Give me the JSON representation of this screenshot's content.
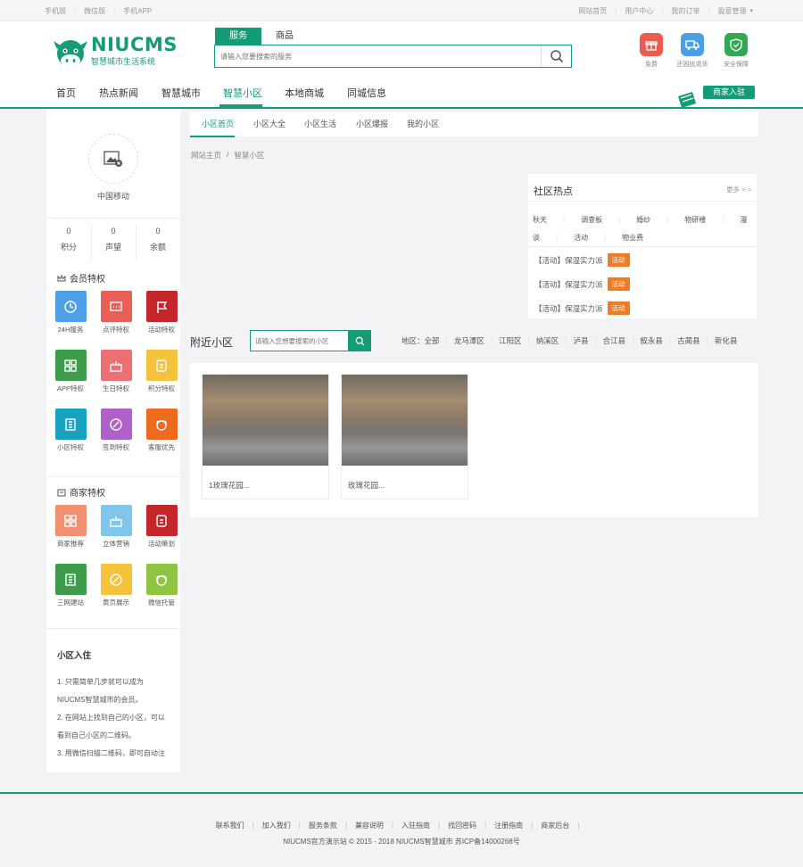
{
  "topbar": {
    "left": [
      "手机版",
      "微信版",
      "手机APP"
    ],
    "right": [
      "网站首页",
      "用户中心",
      "我的订单",
      "盈意管理"
    ]
  },
  "logo": {
    "brand": "NIUCMS",
    "sub": "智慧城市生活系统"
  },
  "search": {
    "tabs": [
      "服务",
      "商品"
    ],
    "placeholder": "请输入您要搜索的服务"
  },
  "header_icons": [
    {
      "label": "免费",
      "color": "#ee5b4c"
    },
    {
      "label": "还困扰退货",
      "color": "#4aa0e2"
    },
    {
      "label": "安全保障",
      "color": "#32a853"
    }
  ],
  "nav": {
    "items": [
      "首页",
      "热点新闻",
      "智慧城市",
      "智慧小区",
      "本地商城",
      "同城信息"
    ],
    "active": 3,
    "join_label": "商家入驻"
  },
  "sidebar": {
    "operator": "中国移动",
    "stats": [
      {
        "value": "0",
        "label": "积分"
      },
      {
        "value": "0",
        "label": "声望"
      },
      {
        "value": "0",
        "label": "余额"
      }
    ],
    "member_title": "会员特权",
    "member_tiles": [
      {
        "label": "24H服务",
        "color": "#4d9fe8"
      },
      {
        "label": "点评特权",
        "color": "#e85f55"
      },
      {
        "label": "活动特权",
        "color": "#c5262a"
      },
      {
        "label": "APP特权",
        "color": "#3e9d4a"
      },
      {
        "label": "生日特权",
        "color": "#ec6f73"
      },
      {
        "label": "积分特权",
        "color": "#f4c23b"
      },
      {
        "label": "小区特权",
        "color": "#17a2c0"
      },
      {
        "label": "签到特权",
        "color": "#b061c9"
      },
      {
        "label": "客服优先",
        "color": "#f06a1d"
      }
    ],
    "merchant_title": "商家特权",
    "merchant_tiles": [
      {
        "label": "商家推荐",
        "color": "#f28f70"
      },
      {
        "label": "立体营销",
        "color": "#7fc5ec"
      },
      {
        "label": "活动策划",
        "color": "#c5262a"
      },
      {
        "label": "三网建站",
        "color": "#3e9d4a"
      },
      {
        "label": "黄页展示",
        "color": "#f4c23b"
      },
      {
        "label": "微信托管",
        "color": "#8fc541"
      }
    ],
    "join_title": "小区入住",
    "join_steps": [
      "1. 只需简单几步就可以成为",
      "NIUCMS智慧城市的会员。",
      "2. 在网站上找到自己的小区，可以",
      "看到自己小区的二维码。",
      "3. 用微信扫描二维码，即可自动注"
    ]
  },
  "subnav": {
    "items": [
      "小区首页",
      "小区大全",
      "小区生活",
      "小区爆报",
      "我的小区"
    ],
    "active": 0
  },
  "breadcrumb": [
    "网站主页",
    "智慧小区"
  ],
  "hot": {
    "title": "社区热点",
    "more": "更多 > >",
    "tags": [
      "秋天",
      "调查板",
      "婚纱",
      "物研楼",
      "漫谈",
      "活动",
      "物业费"
    ],
    "items": [
      {
        "text": "【活动】保湿实力派",
        "badge": "活动"
      },
      {
        "text": "【活动】保湿实力派",
        "badge": "活动"
      },
      {
        "text": "【活动】保湿实力派",
        "badge": "活动"
      }
    ]
  },
  "nearby": {
    "title": "附近小区",
    "placeholder": "请输入您想要搜索的小区",
    "area_label": "地区：全部",
    "areas": [
      "龙马潭区",
      "江阳区",
      "纳溪区",
      "泸县",
      "合江县",
      "叙永县",
      "古蔺县",
      "新化县"
    ]
  },
  "communities": [
    {
      "name": "1玫瑰花园..."
    },
    {
      "name": "玫瑰花园..."
    }
  ],
  "footer": {
    "links": [
      "联系我们",
      "加入我们",
      "服务条款",
      "兼容说明",
      "入驻指南",
      "找回密码",
      "注册指南",
      "商家后台"
    ],
    "copyright": "NIUCMS官方演示站   © 2015 - 2018   NIUCMS智慧城市   苏ICP备14000268号"
  }
}
